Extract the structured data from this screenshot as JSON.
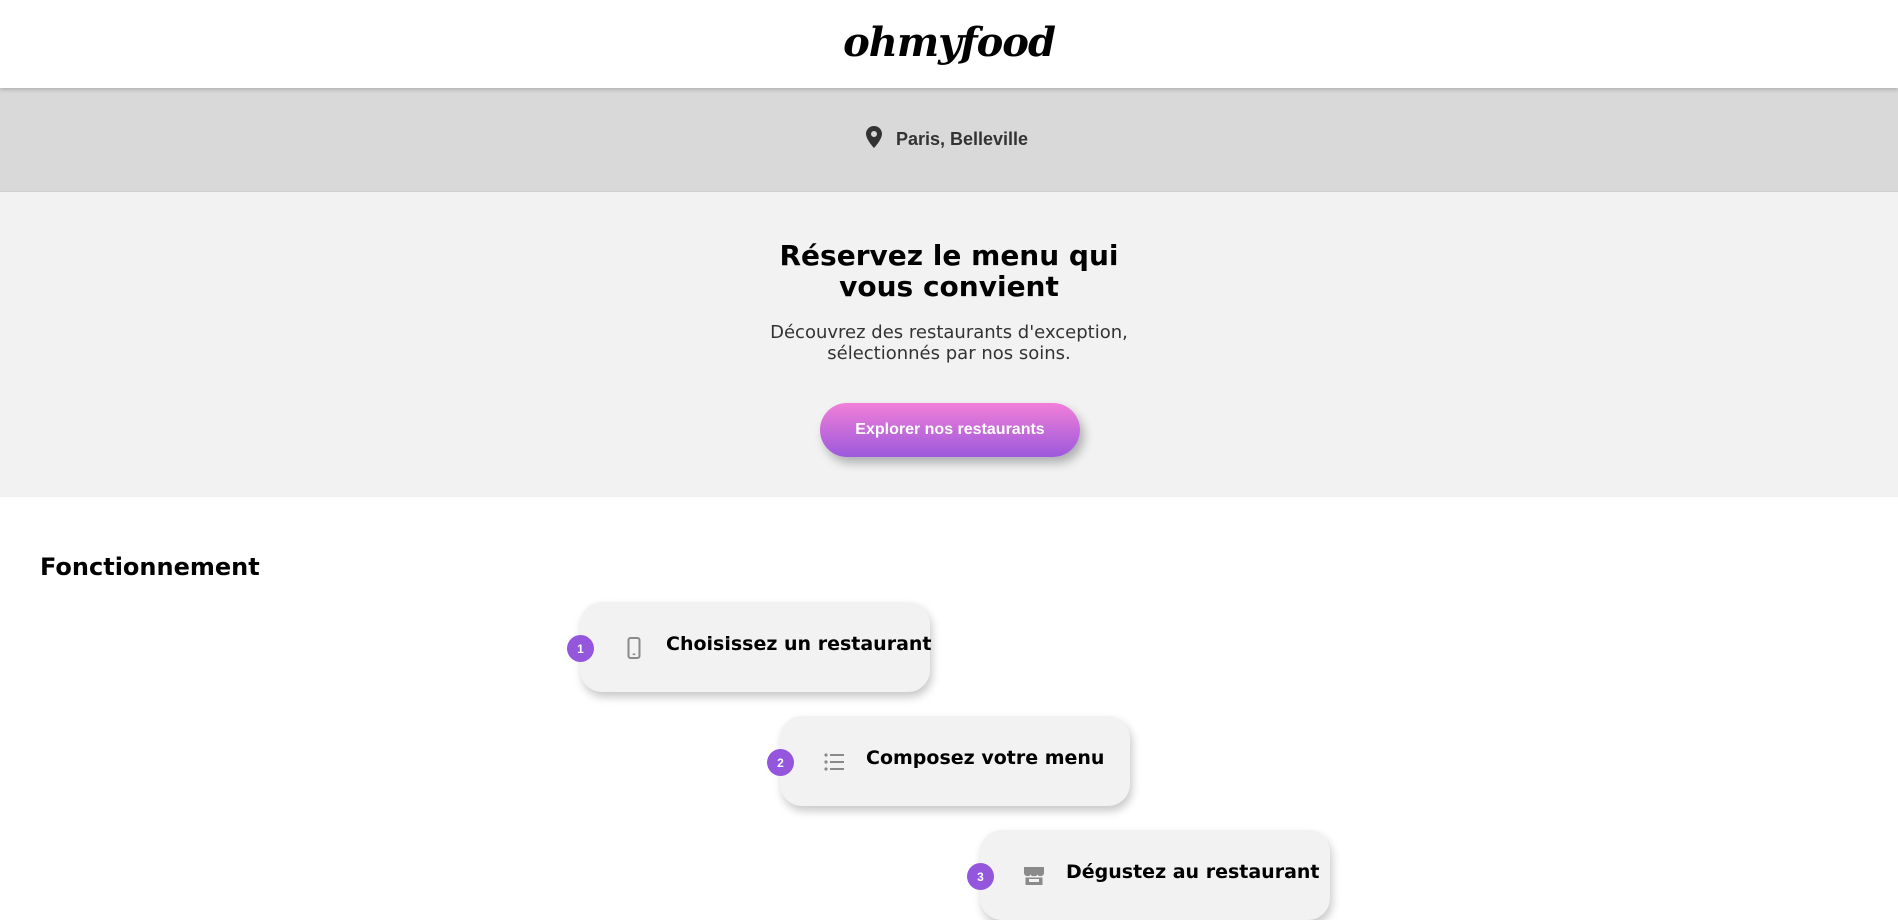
{
  "header": {
    "logo_text": "ohmyfood"
  },
  "location": {
    "icon": "map-pin-icon",
    "text": "Paris, Belleville"
  },
  "hero": {
    "title_line1": "Réservez le menu qui",
    "title_line2": "vous convient",
    "subtitle_line1": "Découvrez des restaurants d'exception,",
    "subtitle_line2": "sélectionnés par nos soins.",
    "cta_label": "Explorer nos restaurants"
  },
  "how_it_works": {
    "title": "Fonctionnement",
    "steps": [
      {
        "number": "1",
        "icon": "mobile-phone-icon",
        "label": "Choisissez un restaurant"
      },
      {
        "number": "2",
        "icon": "list-icon",
        "label": "Composez votre menu"
      },
      {
        "number": "3",
        "icon": "store-icon",
        "label": "Dégustez au restaurant"
      }
    ]
  },
  "colors": {
    "accent_purple": "#9356dc",
    "gradient_start": "#f17fd8",
    "gradient_end": "#9c59dc",
    "location_bg": "#d9d9d9",
    "hero_bg": "#f2f2f2"
  }
}
